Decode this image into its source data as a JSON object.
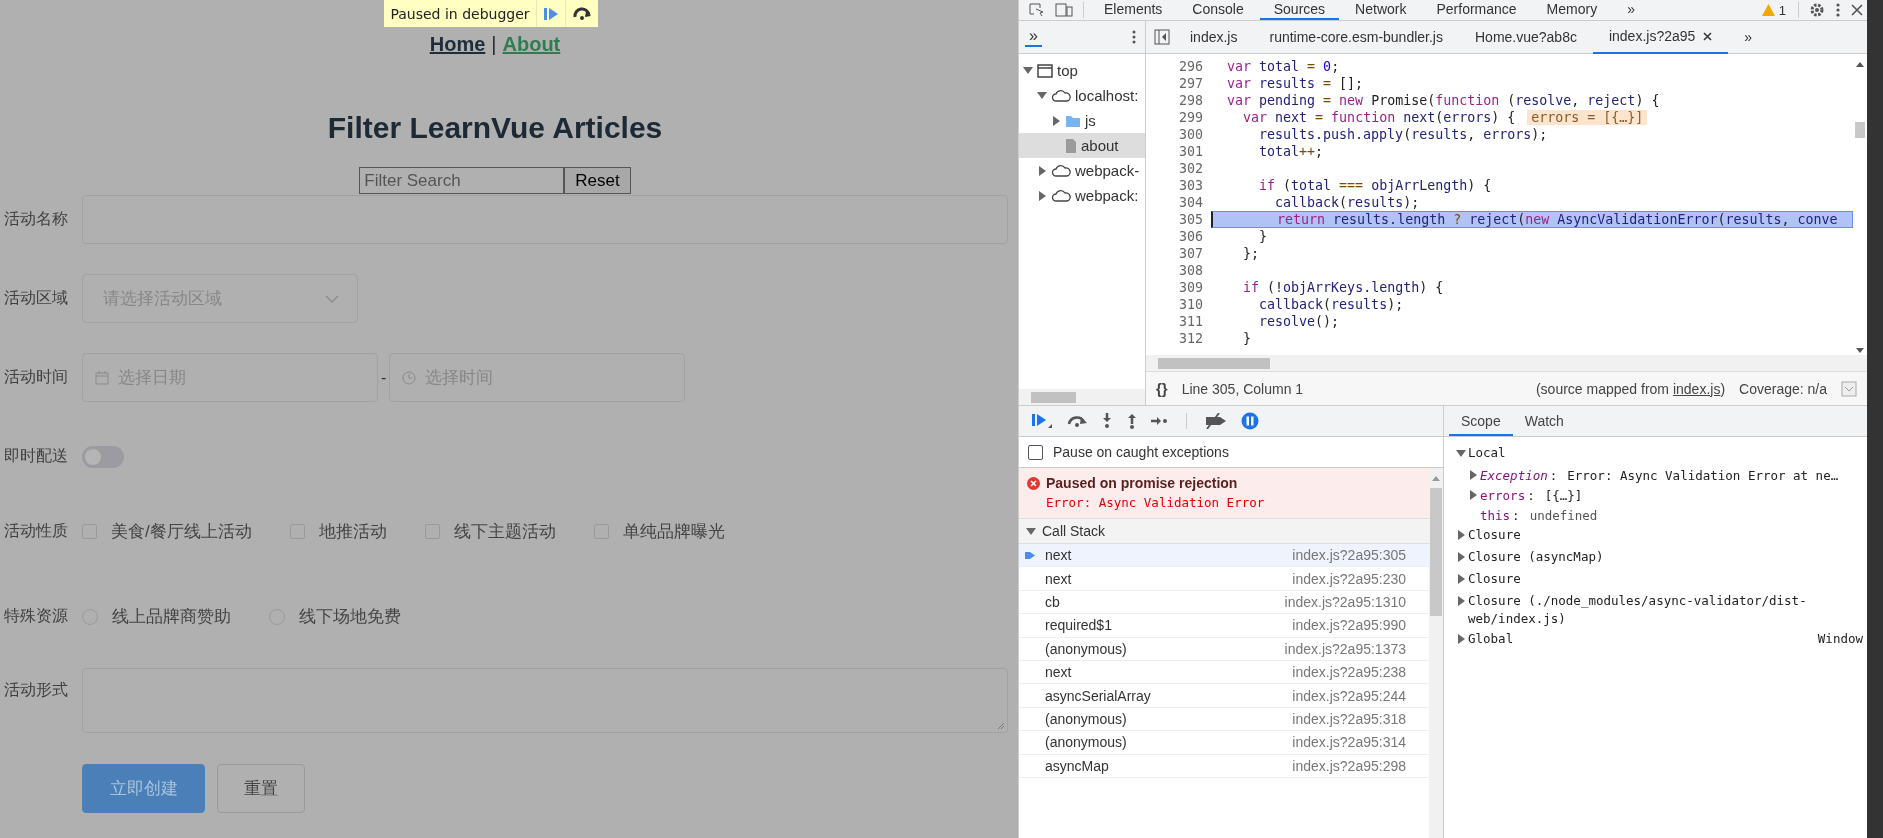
{
  "page": {
    "debugger_banner": {
      "text": "Paused in debugger"
    },
    "nav": [
      {
        "label": "Home",
        "active": false
      },
      {
        "label": "About",
        "active": true
      }
    ],
    "nav_separator": "|",
    "title": "Filter LearnVue Articles",
    "filter": {
      "placeholder": "Filter Search",
      "button": "Reset"
    },
    "form": [
      {
        "kind": "input",
        "label": "活动名称"
      },
      {
        "kind": "select",
        "label": "活动区域",
        "placeholder": "请选择活动区域"
      },
      {
        "kind": "datetime",
        "label": "活动时间",
        "date_placeholder": "选择日期",
        "separator": "-",
        "time_placeholder": "选择时间"
      },
      {
        "kind": "switch",
        "label": "即时配送",
        "on": false
      },
      {
        "kind": "checkboxes",
        "label": "活动性质",
        "options": [
          {
            "label": "美食/餐厅线上活动",
            "checked": false
          },
          {
            "label": "地推活动",
            "checked": false
          },
          {
            "label": "线下主题活动",
            "checked": false
          },
          {
            "label": "单纯品牌曝光",
            "checked": false
          }
        ]
      },
      {
        "kind": "radios",
        "label": "特殊资源",
        "options": [
          {
            "label": "线上品牌商赞助",
            "selected": false
          },
          {
            "label": "线下场地免费",
            "selected": false
          }
        ]
      },
      {
        "kind": "textarea",
        "label": "活动形式"
      }
    ],
    "actions": [
      {
        "label": "立即创建",
        "kind": "primary"
      },
      {
        "label": "重置",
        "kind": "default"
      }
    ]
  },
  "devtools": {
    "tabs": [
      {
        "label": "Elements",
        "selected": false
      },
      {
        "label": "Console",
        "selected": false
      },
      {
        "label": "Sources",
        "selected": true
      },
      {
        "label": "Network",
        "selected": false
      },
      {
        "label": "Performance",
        "selected": false
      },
      {
        "label": "Memory",
        "selected": false
      }
    ],
    "more_tabs": "»",
    "warnings": "1",
    "navigator": {
      "more": "»",
      "tree": [
        {
          "label": "top",
          "kind": "frame",
          "expanded": true,
          "selected": false,
          "children": [
            {
              "label": "localhost:",
              "kind": "cloud",
              "expanded": true,
              "selected": false,
              "children": [
                {
                  "label": "js",
                  "kind": "folder",
                  "expanded": false,
                  "selected": false
                },
                {
                  "label": "about",
                  "kind": "file",
                  "selected": true
                }
              ]
            },
            {
              "label": "webpack-",
              "kind": "cloud",
              "expanded": false,
              "selected": false
            },
            {
              "label": "webpack:",
              "kind": "cloud",
              "expanded": false,
              "selected": false
            }
          ]
        }
      ]
    },
    "files": [
      {
        "label": "index.js",
        "selected": false,
        "closable": false
      },
      {
        "label": "runtime-core.esm-bundler.js",
        "selected": false,
        "closable": false
      },
      {
        "label": "Home.vue?ab8c",
        "selected": false,
        "closable": false
      },
      {
        "label": "index.js?2a95",
        "selected": true,
        "closable": true
      }
    ],
    "files_more": "»",
    "code": [
      {
        "n": "296",
        "current": false,
        "tokens": [
          {
            "text": "  var",
            "kind": "keyword"
          },
          {
            "text": " total",
            "kind": "ident"
          },
          {
            "text": " = ",
            "kind": "op"
          },
          {
            "text": "0",
            "kind": "number"
          },
          {
            "text": ";",
            "kind": "punct"
          }
        ]
      },
      {
        "n": "297",
        "current": false,
        "tokens": [
          {
            "text": "  var",
            "kind": "keyword"
          },
          {
            "text": " results",
            "kind": "ident"
          },
          {
            "text": " = ",
            "kind": "op"
          },
          {
            "text": "[];",
            "kind": "punct"
          }
        ]
      },
      {
        "n": "298",
        "current": false,
        "tokens": [
          {
            "text": "  var",
            "kind": "keyword"
          },
          {
            "text": " pending",
            "kind": "ident"
          },
          {
            "text": " = ",
            "kind": "op"
          },
          {
            "text": "new",
            "kind": "keyword"
          },
          {
            "text": " Promise(",
            "kind": "punct"
          },
          {
            "text": "function",
            "kind": "keyword"
          },
          {
            "text": " (",
            "kind": "punct"
          },
          {
            "text": "resolve",
            "kind": "ident"
          },
          {
            "text": ", ",
            "kind": "punct"
          },
          {
            "text": "reject",
            "kind": "ident"
          },
          {
            "text": ") {",
            "kind": "punct"
          }
        ]
      },
      {
        "n": "299",
        "current": false,
        "inline_value": "errors = [{…}]",
        "tokens": [
          {
            "text": "    var",
            "kind": "keyword"
          },
          {
            "text": " next",
            "kind": "ident"
          },
          {
            "text": " = ",
            "kind": "op"
          },
          {
            "text": "function",
            "kind": "keyword"
          },
          {
            "text": " next",
            "kind": "ident"
          },
          {
            "text": "(",
            "kind": "punct"
          },
          {
            "text": "errors",
            "kind": "ident"
          },
          {
            "text": ") {",
            "kind": "punct"
          }
        ]
      },
      {
        "n": "300",
        "current": false,
        "tokens": [
          {
            "text": "      results.push.apply",
            "kind": "ident"
          },
          {
            "text": "(",
            "kind": "punct"
          },
          {
            "text": "results",
            "kind": "ident"
          },
          {
            "text": ", ",
            "kind": "punct"
          },
          {
            "text": "errors",
            "kind": "ident"
          },
          {
            "text": ");",
            "kind": "punct"
          }
        ]
      },
      {
        "n": "301",
        "current": false,
        "tokens": [
          {
            "text": "      total",
            "kind": "ident"
          },
          {
            "text": "++",
            "kind": "op"
          },
          {
            "text": ";",
            "kind": "punct"
          }
        ]
      },
      {
        "n": "302",
        "current": false
      },
      {
        "n": "303",
        "current": false,
        "tokens": [
          {
            "text": "      if",
            "kind": "keyword"
          },
          {
            "text": " (",
            "kind": "punct"
          },
          {
            "text": "total",
            "kind": "ident"
          },
          {
            "text": " === ",
            "kind": "op"
          },
          {
            "text": "objArrLength",
            "kind": "ident"
          },
          {
            "text": ") {",
            "kind": "punct"
          }
        ]
      },
      {
        "n": "304",
        "current": false,
        "tokens": [
          {
            "text": "        callback",
            "kind": "ident"
          },
          {
            "text": "(",
            "kind": "punct"
          },
          {
            "text": "results",
            "kind": "ident"
          },
          {
            "text": ");",
            "kind": "punct"
          }
        ]
      },
      {
        "n": "305",
        "current": true,
        "tokens": [
          {
            "text": "        return",
            "kind": "keyword"
          },
          {
            "text": " results.length",
            "kind": "ident"
          },
          {
            "text": " ? ",
            "kind": "op"
          },
          {
            "text": "reject",
            "kind": "ident"
          },
          {
            "text": "(",
            "kind": "punct"
          },
          {
            "text": "new",
            "kind": "keyword"
          },
          {
            "text": " AsyncValidationError",
            "kind": "ident"
          },
          {
            "text": "(",
            "kind": "punct"
          },
          {
            "text": "results",
            "kind": "ident"
          },
          {
            "text": ", ",
            "kind": "punct"
          },
          {
            "text": "conve",
            "kind": "ident"
          }
        ]
      },
      {
        "n": "306",
        "current": false,
        "tokens": [
          {
            "text": "      }",
            "kind": "punct"
          }
        ]
      },
      {
        "n": "307",
        "current": false,
        "tokens": [
          {
            "text": "    };",
            "kind": "punct"
          }
        ]
      },
      {
        "n": "308",
        "current": false
      },
      {
        "n": "309",
        "current": false,
        "tokens": [
          {
            "text": "    if",
            "kind": "keyword"
          },
          {
            "text": " (!",
            "kind": "punct"
          },
          {
            "text": "objArrKeys.length",
            "kind": "ident"
          },
          {
            "text": ") {",
            "kind": "punct"
          }
        ]
      },
      {
        "n": "310",
        "current": false,
        "tokens": [
          {
            "text": "      callback",
            "kind": "ident"
          },
          {
            "text": "(",
            "kind": "punct"
          },
          {
            "text": "results",
            "kind": "ident"
          },
          {
            "text": ");",
            "kind": "punct"
          }
        ]
      },
      {
        "n": "311",
        "current": false,
        "tokens": [
          {
            "text": "      resolve",
            "kind": "ident"
          },
          {
            "text": "();",
            "kind": "punct"
          }
        ]
      },
      {
        "n": "312",
        "current": false,
        "tokens": [
          {
            "text": "    }",
            "kind": "punct"
          }
        ]
      }
    ],
    "status": {
      "pretty_print": "{}",
      "position": "Line 305, Column 1",
      "source_before": "(source mapped from ",
      "source_link": "index.js",
      "source_after": ")",
      "coverage": "Coverage: n/a"
    },
    "debugger": {
      "pause_on_caught": {
        "label": "Pause on caught exceptions",
        "checked": false
      },
      "pause_on_exceptions": true,
      "paused": {
        "title": "Paused on promise rejection",
        "error": "Error: Async Validation Error"
      },
      "call_stack": {
        "label": "Call Stack",
        "expanded": true,
        "frames": [
          {
            "name": "next",
            "location": "index.js?2a95:305",
            "selected": true
          },
          {
            "name": "next",
            "location": "index.js?2a95:230",
            "selected": false
          },
          {
            "name": "cb",
            "location": "index.js?2a95:1310",
            "selected": false
          },
          {
            "name": "required$1",
            "location": "index.js?2a95:990",
            "selected": false
          },
          {
            "name": "(anonymous)",
            "location": "index.js?2a95:1373",
            "selected": false
          },
          {
            "name": "next",
            "location": "index.js?2a95:238",
            "selected": false
          },
          {
            "name": "asyncSerialArray",
            "location": "index.js?2a95:244",
            "selected": false
          },
          {
            "name": "(anonymous)",
            "location": "index.js?2a95:318",
            "selected": false
          },
          {
            "name": "(anonymous)",
            "location": "index.js?2a95:314",
            "selected": false
          },
          {
            "name": "asyncMap",
            "location": "index.js?2a95:298",
            "selected": false
          }
        ]
      }
    },
    "sidebar_tabs": [
      {
        "label": "Scope",
        "selected": true
      },
      {
        "label": "Watch",
        "selected": false
      }
    ],
    "scope": [
      {
        "label": "Local",
        "expanded": true,
        "children": [
          {
            "kind": "object",
            "name": "Exception",
            "sep": ":",
            "italic": true,
            "value": "Error: Async Validation Error at ne…",
            "expanded": false
          },
          {
            "kind": "object",
            "name": "errors",
            "sep": ":",
            "italic": false,
            "value": "[{…}]",
            "expanded": false
          },
          {
            "kind": "leaf",
            "name": "this",
            "sep": ":",
            "italic": false,
            "value": "undefined"
          }
        ]
      },
      {
        "label": "Closure",
        "expanded": false
      },
      {
        "label": "Closure (asyncMap)",
        "expanded": false
      },
      {
        "label": "Closure",
        "expanded": false
      },
      {
        "label": "Closure (./node_modules/async-validator/dist-web/index.js)",
        "expanded": false
      },
      {
        "label": "Global",
        "expanded": false,
        "value": "Window"
      }
    ]
  }
}
